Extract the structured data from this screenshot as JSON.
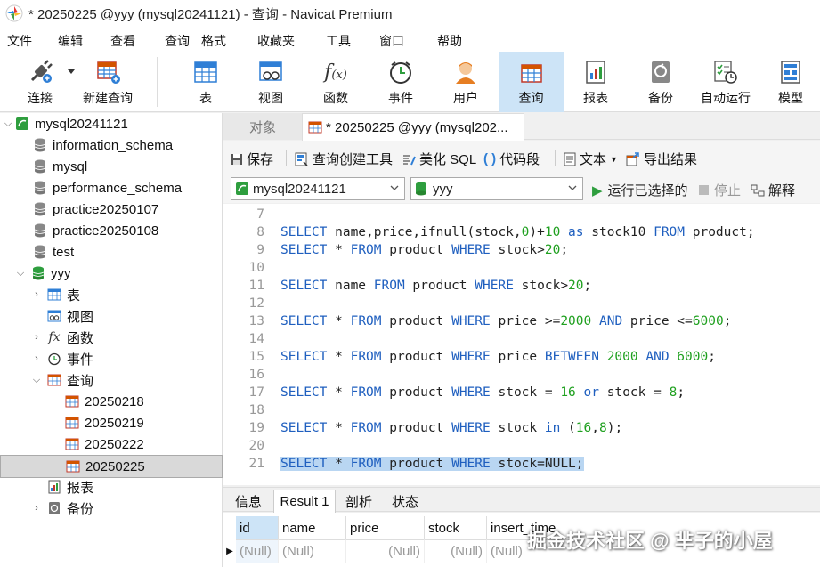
{
  "window": {
    "title": "* 20250225 @yyy (mysql20241121) - 查询 - Navicat Premium"
  },
  "menu": [
    "文件",
    "编辑",
    "查看",
    "查询",
    "格式",
    "收藏夹",
    "工具",
    "窗口",
    "帮助"
  ],
  "toolbar": {
    "connect": "连接",
    "new_query": "新建查询",
    "table": "表",
    "view": "视图",
    "function": "函数",
    "event": "事件",
    "user": "用户",
    "query": "查询",
    "report": "报表",
    "backup": "备份",
    "automation": "自动运行",
    "model": "模型"
  },
  "tree": {
    "connection": "mysql20241121",
    "databases": [
      "information_schema",
      "mysql",
      "performance_schema",
      "practice20250107",
      "practice20250108",
      "test"
    ],
    "open_db": "yyy",
    "groups": {
      "tables": "表",
      "views": "视图",
      "functions": "函数",
      "events": "事件",
      "queries": "查询",
      "reports": "报表",
      "backups": "备份"
    },
    "queries": [
      "20250218",
      "20250219",
      "20250222",
      "20250225"
    ]
  },
  "tabs": {
    "objects": "对象",
    "active": "* 20250225 @yyy (mysql202..."
  },
  "query_toolbar": {
    "save": "保存",
    "builder": "查询创建工具",
    "beautify": "美化 SQL",
    "snippet": "代码段",
    "text": "文本",
    "export": "导出结果"
  },
  "selectors": {
    "connection": "mysql20241121",
    "database": "yyy",
    "run_selected": "运行已选择的",
    "stop": "停止",
    "explain": "解释"
  },
  "editor": {
    "lines": [
      {
        "n": "7",
        "tokens": []
      },
      {
        "n": "8",
        "tokens": [
          [
            "kw",
            "SELECT"
          ],
          [
            "t",
            " name,price,ifnull(stock,"
          ],
          [
            "num",
            "0"
          ],
          [
            "t",
            ")+"
          ],
          [
            "num",
            "10"
          ],
          [
            "t",
            " "
          ],
          [
            "kw",
            "as"
          ],
          [
            "t",
            " stock10 "
          ],
          [
            "kw",
            "FROM"
          ],
          [
            "t",
            " product;"
          ]
        ]
      },
      {
        "n": "9",
        "tokens": [
          [
            "kw",
            "SELECT"
          ],
          [
            "t",
            " * "
          ],
          [
            "kw",
            "FROM"
          ],
          [
            "t",
            " product "
          ],
          [
            "kw",
            "WHERE"
          ],
          [
            "t",
            " stock>"
          ],
          [
            "num",
            "20"
          ],
          [
            "t",
            ";"
          ]
        ]
      },
      {
        "n": "10",
        "tokens": []
      },
      {
        "n": "11",
        "tokens": [
          [
            "kw",
            "SELECT"
          ],
          [
            "t",
            " name "
          ],
          [
            "kw",
            "FROM"
          ],
          [
            "t",
            " product "
          ],
          [
            "kw",
            "WHERE"
          ],
          [
            "t",
            " stock>"
          ],
          [
            "num",
            "20"
          ],
          [
            "t",
            ";"
          ]
        ]
      },
      {
        "n": "12",
        "tokens": []
      },
      {
        "n": "13",
        "tokens": [
          [
            "kw",
            "SELECT"
          ],
          [
            "t",
            " * "
          ],
          [
            "kw",
            "FROM"
          ],
          [
            "t",
            " product "
          ],
          [
            "kw",
            "WHERE"
          ],
          [
            "t",
            " price >="
          ],
          [
            "num",
            "2000"
          ],
          [
            "t",
            " "
          ],
          [
            "kw",
            "AND"
          ],
          [
            "t",
            " price <="
          ],
          [
            "num",
            "6000"
          ],
          [
            "t",
            ";"
          ]
        ]
      },
      {
        "n": "14",
        "tokens": []
      },
      {
        "n": "15",
        "tokens": [
          [
            "kw",
            "SELECT"
          ],
          [
            "t",
            " * "
          ],
          [
            "kw",
            "FROM"
          ],
          [
            "t",
            " product "
          ],
          [
            "kw",
            "WHERE"
          ],
          [
            "t",
            " price "
          ],
          [
            "kw",
            "BETWEEN"
          ],
          [
            "t",
            " "
          ],
          [
            "num",
            "2000"
          ],
          [
            "t",
            " "
          ],
          [
            "kw",
            "AND"
          ],
          [
            "t",
            " "
          ],
          [
            "num",
            "6000"
          ],
          [
            "t",
            ";"
          ]
        ]
      },
      {
        "n": "16",
        "tokens": []
      },
      {
        "n": "17",
        "tokens": [
          [
            "kw",
            "SELECT"
          ],
          [
            "t",
            " * "
          ],
          [
            "kw",
            "FROM"
          ],
          [
            "t",
            " product "
          ],
          [
            "kw",
            "WHERE"
          ],
          [
            "t",
            " stock = "
          ],
          [
            "num",
            "16"
          ],
          [
            "t",
            " "
          ],
          [
            "kw",
            "or"
          ],
          [
            "t",
            " stock = "
          ],
          [
            "num",
            "8"
          ],
          [
            "t",
            ";"
          ]
        ]
      },
      {
        "n": "18",
        "tokens": []
      },
      {
        "n": "19",
        "tokens": [
          [
            "kw",
            "SELECT"
          ],
          [
            "t",
            " * "
          ],
          [
            "kw",
            "FROM"
          ],
          [
            "t",
            " product "
          ],
          [
            "kw",
            "WHERE"
          ],
          [
            "t",
            " stock "
          ],
          [
            "kw",
            "in"
          ],
          [
            "t",
            " ("
          ],
          [
            "num",
            "16"
          ],
          [
            "t",
            ","
          ],
          [
            "num",
            "8"
          ],
          [
            "t",
            ");"
          ]
        ]
      },
      {
        "n": "20",
        "tokens": []
      },
      {
        "n": "21",
        "highlight": true,
        "tokens": [
          [
            "kw",
            "SELECT"
          ],
          [
            "t",
            " * "
          ],
          [
            "kw",
            "FROM"
          ],
          [
            "t",
            " product "
          ],
          [
            "kw",
            "WHERE"
          ],
          [
            "t",
            " stock=NULL;"
          ]
        ]
      }
    ]
  },
  "result_tabs": [
    "信息",
    "Result 1",
    "剖析",
    "状态"
  ],
  "result": {
    "columns": [
      "id",
      "name",
      "price",
      "stock",
      "insert_time"
    ],
    "row": [
      "(Null)",
      "(Null)",
      "(Null)",
      "(Null)",
      "(Null)"
    ]
  },
  "watermark": "掘金技术社区 @ 芈子的小屋",
  "colors": {
    "keyword": "#1f5fbf",
    "number": "#1fa01f",
    "selection": "#b9d6f2",
    "active_tool": "#cde4f7"
  }
}
